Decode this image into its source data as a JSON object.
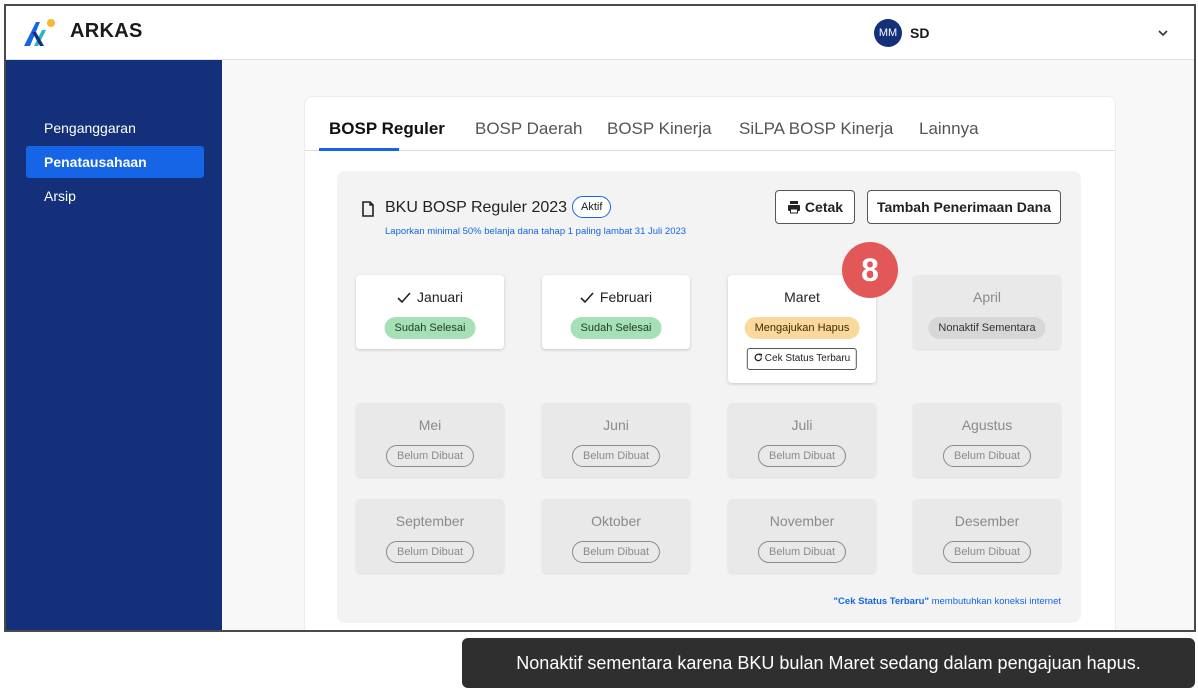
{
  "header": {
    "brand": "ARKAS",
    "avatar_initials": "MM",
    "user_name": "SD"
  },
  "sidebar": {
    "items": [
      {
        "label": "Penganggaran",
        "active": false
      },
      {
        "label": "Penatausahaan",
        "active": true
      },
      {
        "label": "Arsip",
        "active": false
      }
    ]
  },
  "tabs": [
    {
      "label": "BOSP Reguler",
      "active": true
    },
    {
      "label": "BOSP Daerah",
      "active": false
    },
    {
      "label": "BOSP Kinerja",
      "active": false
    },
    {
      "label": "SiLPA BOSP Kinerja",
      "active": false
    },
    {
      "label": "Lainnya",
      "active": false
    }
  ],
  "bku": {
    "title": "BKU BOSP Reguler 2023",
    "badge": "Aktif",
    "note": "Laporkan minimal 50% belanja dana tahap 1 paling lambat 31 Juli 2023",
    "cetak_label": "Cetak",
    "tambah_label": "Tambah Penerimaan Dana"
  },
  "months": [
    {
      "name": "Januari",
      "status": "Sudah Selesai",
      "checked": true
    },
    {
      "name": "Februari",
      "status": "Sudah Selesai",
      "checked": true
    },
    {
      "name": "Maret",
      "status": "Mengajukan Hapus",
      "action": "Cek Status Terbaru"
    },
    {
      "name": "April",
      "status": "Nonaktif Sementara"
    },
    {
      "name": "Mei",
      "status": "Belum Dibuat"
    },
    {
      "name": "Juni",
      "status": "Belum Dibuat"
    },
    {
      "name": "Juli",
      "status": "Belum Dibuat"
    },
    {
      "name": "Agustus",
      "status": "Belum Dibuat"
    },
    {
      "name": "September",
      "status": "Belum Dibuat"
    },
    {
      "name": "Oktober",
      "status": "Belum Dibuat"
    },
    {
      "name": "November",
      "status": "Belum Dibuat"
    },
    {
      "name": "Desember",
      "status": "Belum Dibuat"
    }
  ],
  "footnote": {
    "highlight": "\"Cek Status Terbaru\"",
    "text": " membutuhkan koneksi internet"
  },
  "step_marker": "8",
  "tooltip": "Nonaktif sementara karena BKU bulan Maret sedang dalam pengajuan hapus.",
  "colors": {
    "primary": "#1565e6",
    "sidebar": "#15307a",
    "success": "#a6e0b7",
    "warning": "#fbd89b",
    "marker": "#e25757"
  }
}
